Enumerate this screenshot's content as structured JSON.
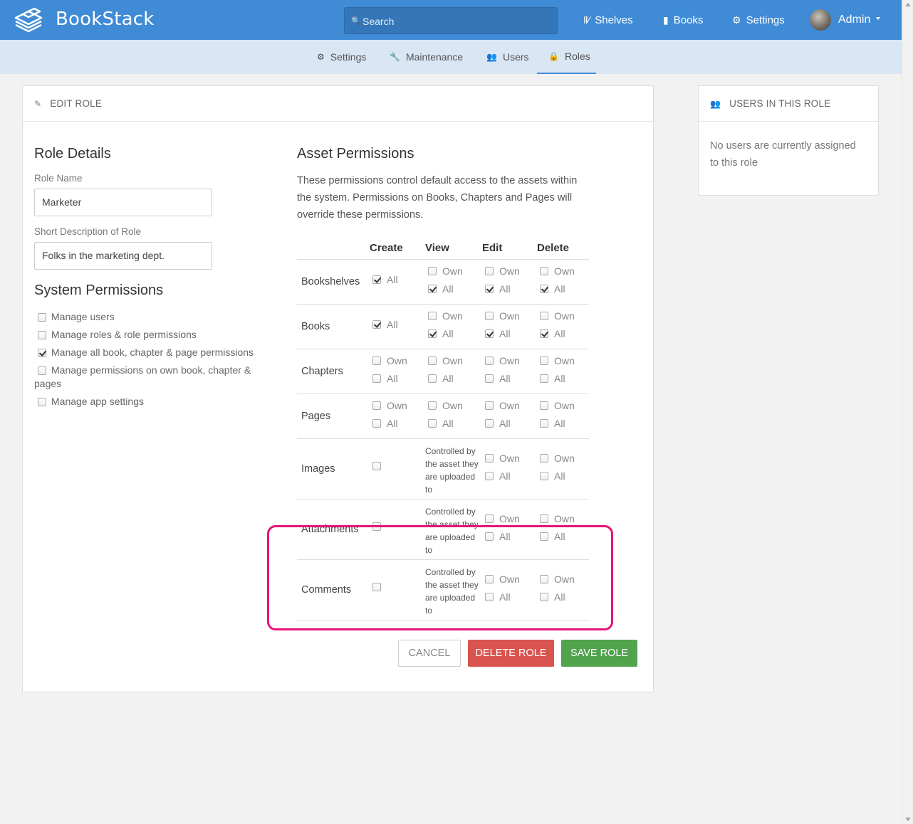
{
  "header": {
    "brand": "BookStack",
    "search_placeholder": "Search",
    "nav": [
      {
        "label": "Shelves",
        "icon": "shelves-icon"
      },
      {
        "label": "Books",
        "icon": "book-icon"
      },
      {
        "label": "Settings",
        "icon": "gear-icon"
      }
    ],
    "user": {
      "name": "Admin"
    }
  },
  "subnav": [
    {
      "label": "Settings",
      "icon": "gear-icon"
    },
    {
      "label": "Maintenance",
      "icon": "wrench-icon"
    },
    {
      "label": "Users",
      "icon": "users-icon"
    },
    {
      "label": "Roles",
      "icon": "lock-icon",
      "active": true
    }
  ],
  "edit_role": {
    "card_title": "EDIT ROLE",
    "role_details_heading": "Role Details",
    "role_name_label": "Role Name",
    "role_name_value": "Marketer",
    "short_desc_label": "Short Description of Role",
    "short_desc_value": "Folks in the marketing dept.",
    "system_permissions_heading": "System Permissions",
    "system_permissions": [
      {
        "label": "Manage users",
        "checked": false
      },
      {
        "label": "Manage roles & role permissions",
        "checked": false
      },
      {
        "label": "Manage all book, chapter & page permissions",
        "checked": true
      },
      {
        "label": "Manage permissions on own book, chapter & pages",
        "checked": false
      },
      {
        "label": "Manage app settings",
        "checked": false
      }
    ],
    "asset_permissions_heading": "Asset Permissions",
    "asset_permissions_desc": "These permissions control default access to the assets within the system. Permissions on Books, Chapters and Pages will override these permissions.",
    "columns": [
      "Create",
      "View",
      "Edit",
      "Delete"
    ],
    "own_label": "Own",
    "all_label": "All",
    "controlled_text": "Controlled by the asset they are uploaded to",
    "rows": [
      {
        "label": "Bookshelves"
      },
      {
        "label": "Books"
      },
      {
        "label": "Chapters"
      },
      {
        "label": "Pages"
      },
      {
        "label": "Images"
      },
      {
        "label": "Attachments"
      },
      {
        "label": "Comments"
      }
    ],
    "buttons": {
      "cancel": "CANCEL",
      "delete": "DELETE ROLE",
      "save": "SAVE ROLE"
    },
    "highlight_color": "#e6137b"
  },
  "users_in_role": {
    "title": "USERS IN THIS ROLE",
    "empty_text": "No users are currently assigned to this role"
  },
  "colors": {
    "primary": "#3f8bd6",
    "danger": "#d9534f",
    "success": "#52a34e"
  }
}
